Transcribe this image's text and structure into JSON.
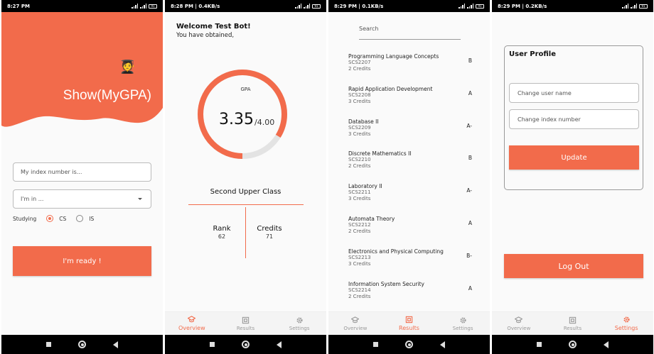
{
  "colors": {
    "accent": "#f26b4b",
    "background": "#fafafa",
    "statusbar": "#000000"
  },
  "screens": {
    "login": {
      "status_time": "8:27 PM",
      "status_speed": "",
      "battery": "91",
      "app_title": "Show(MyGPA)",
      "index_placeholder": "My index number is...",
      "program_placeholder": "I'm in ...",
      "studying_label": "Studying",
      "options": [
        "CS",
        "IS"
      ],
      "selected_option": "CS",
      "submit_label": "I'm ready !"
    },
    "overview": {
      "status_time": "8:28 PM",
      "status_speed": "0.4KB/s",
      "battery": "91",
      "welcome": "Welcome Test Bot!",
      "subtitle": "You have obtained,",
      "gpa_label": "GPA",
      "gpa_value": "3.35",
      "gpa_max": "/4.00",
      "gpa_fraction": 0.8375,
      "class_label": "Second Upper Class",
      "rank_label": "Rank",
      "rank_value": "62",
      "credits_label": "Credits",
      "credits_value": "71"
    },
    "results": {
      "status_time": "8:29 PM",
      "status_speed": "0.1KB/s",
      "battery": "91",
      "search_placeholder": "Search",
      "courses": [
        {
          "name": "Programming Language Concepts",
          "code": "SCS2207",
          "credits": "2 Credits",
          "grade": "B"
        },
        {
          "name": "Rapid Application Development",
          "code": "SCS2208",
          "credits": "3 Credits",
          "grade": "A"
        },
        {
          "name": "Database II",
          "code": "SCS2209",
          "credits": "3 Credits",
          "grade": "A-"
        },
        {
          "name": "Discrete Mathematics II",
          "code": "SCS2210",
          "credits": "2 Credits",
          "grade": "B"
        },
        {
          "name": "Laboratory II",
          "code": "SCS2211",
          "credits": "3 Credits",
          "grade": "A-"
        },
        {
          "name": "Automata Theory",
          "code": "SCS2212",
          "credits": "2 Credits",
          "grade": "A"
        },
        {
          "name": "Electronics and Physical Computing",
          "code": "SCS2213",
          "credits": "3 Credits",
          "grade": "B-"
        },
        {
          "name": "Information System Security",
          "code": "SCS2214",
          "credits": "2 Credits",
          "grade": "A"
        }
      ]
    },
    "settings": {
      "status_time": "8:29 PM",
      "status_speed": "0.2KB/s",
      "battery": "91",
      "profile_title": "User Profile",
      "username_placeholder": "Change user name",
      "index_placeholder": "Change index number",
      "update_label": "Update",
      "logout_label": "Log Out"
    }
  },
  "tabs": [
    {
      "label": "Overview",
      "icon": "graduation-cap-icon"
    },
    {
      "label": "Results",
      "icon": "results-icon"
    },
    {
      "label": "Settings",
      "icon": "gear-icon"
    }
  ]
}
